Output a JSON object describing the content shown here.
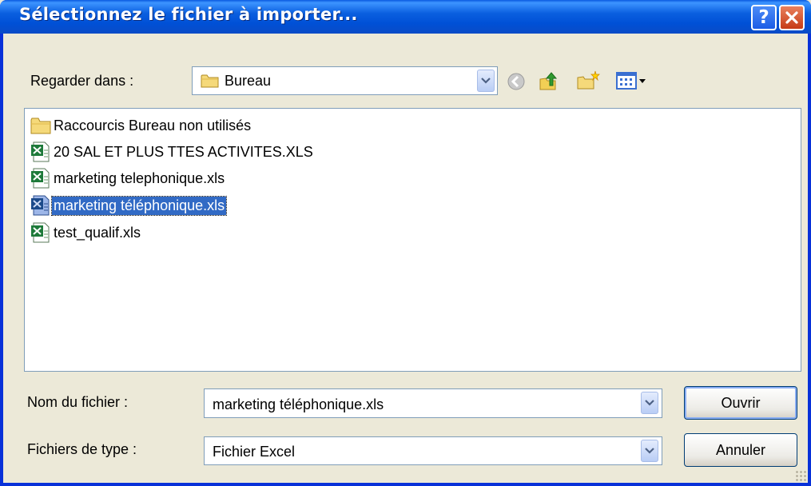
{
  "window": {
    "title": "Sélectionnez le fichier à importer...",
    "help_button": "?",
    "close_button": "X"
  },
  "look_in": {
    "label": "Regarder dans :",
    "value": "Bureau",
    "value_icon": "folder-icon"
  },
  "toolbar": {
    "icons": [
      "back-icon",
      "up-folder-icon",
      "new-folder-icon",
      "view-menu-icon"
    ]
  },
  "files": [
    {
      "name": "Raccourcis Bureau non utilisés",
      "icon": "folder-icon",
      "selected": false
    },
    {
      "name": "20 SAL ET PLUS TTES ACTIVITES.XLS",
      "icon": "excel-file-icon",
      "selected": false
    },
    {
      "name": "marketing telephonique.xls",
      "icon": "excel-file-icon",
      "selected": false
    },
    {
      "name": "marketing téléphonique.xls",
      "icon": "excel-file-icon",
      "selected": true
    },
    {
      "name": "test_qualif.xls",
      "icon": "excel-file-icon",
      "selected": false
    }
  ],
  "filename": {
    "label": "Nom du fichier :",
    "value": "marketing téléphonique.xls"
  },
  "filetype": {
    "label": "Fichiers de type :",
    "value": "Fichier Excel"
  },
  "buttons": {
    "open": "Ouvrir",
    "cancel": "Annuler"
  },
  "colors": {
    "titlebar": "#0a5fdf",
    "selection": "#316ac5",
    "dialog_bg": "#ece9d8"
  }
}
